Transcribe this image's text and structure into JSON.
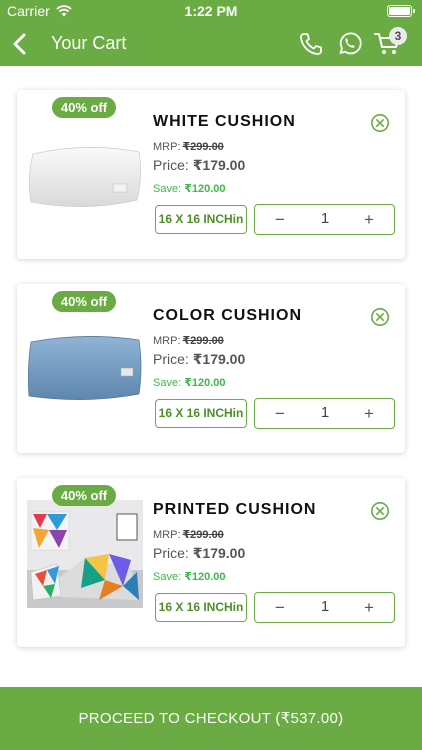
{
  "status_bar": {
    "carrier": "Carrier",
    "time": "1:22 PM"
  },
  "header": {
    "title": "Your Cart",
    "cart_count": "3"
  },
  "colors": {
    "brand": "#6aac43",
    "save_text": "#3db84a"
  },
  "labels": {
    "mrp": "MRP:",
    "price": "Price:",
    "save": "Save:"
  },
  "items": [
    {
      "name": "WHITE CUSHION",
      "discount": "40% off",
      "mrp": "₹299.00",
      "price": "₹179.00",
      "save": "₹120.00",
      "size": "16 X 16 INCHin",
      "quantity": "1",
      "minus": "−",
      "plus": "+",
      "image": "white cushion photo"
    },
    {
      "name": "COLOR CUSHION",
      "discount": "40% off",
      "mrp": "₹299.00",
      "price": "₹179.00",
      "save": "₹120.00",
      "size": "16 X 16 INCHin",
      "quantity": "1",
      "minus": "−",
      "plus": "+",
      "image": "blue cushion photo"
    },
    {
      "name": "PRINTED CUSHION",
      "discount": "40% off",
      "mrp": "₹299.00",
      "price": "₹179.00",
      "save": "₹120.00",
      "size": "16 X 16 INCHin",
      "quantity": "1",
      "minus": "−",
      "plus": "+",
      "image": "printed cushions photo"
    }
  ],
  "checkout": {
    "label": "PROCEED TO CHECKOUT (₹537.00)"
  }
}
